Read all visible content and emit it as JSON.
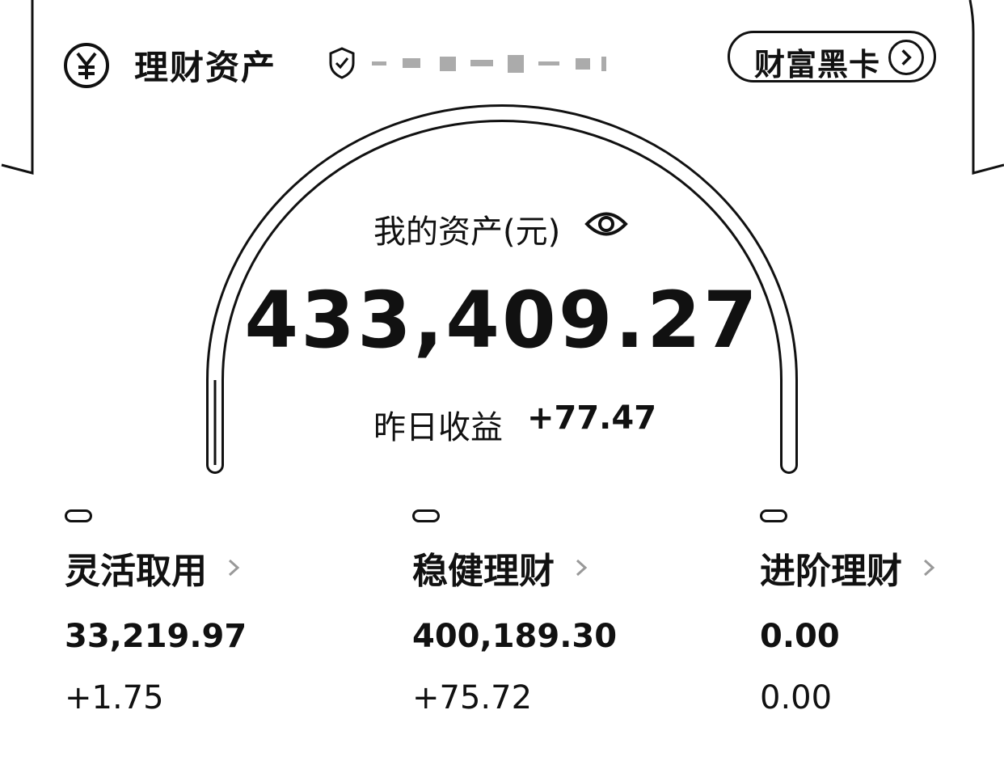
{
  "header": {
    "title": "理财资产",
    "card_button": "财富黑卡",
    "icon": "yuan-circle-icon",
    "shield_icon": "shield-icon"
  },
  "summary": {
    "assets_label": "我的资产(元)",
    "total": "433,409.27",
    "yesterday_label": "昨日收益",
    "yesterday_value": "+77.47",
    "eye_icon": "eye-icon"
  },
  "categories": [
    {
      "name": "灵活取用",
      "amount": "33,219.97",
      "income": "+1.75"
    },
    {
      "name": "稳健理财",
      "amount": "400,189.30",
      "income": "+75.72"
    },
    {
      "name": "进阶理财",
      "amount": "0.00",
      "income": "0.00"
    }
  ]
}
